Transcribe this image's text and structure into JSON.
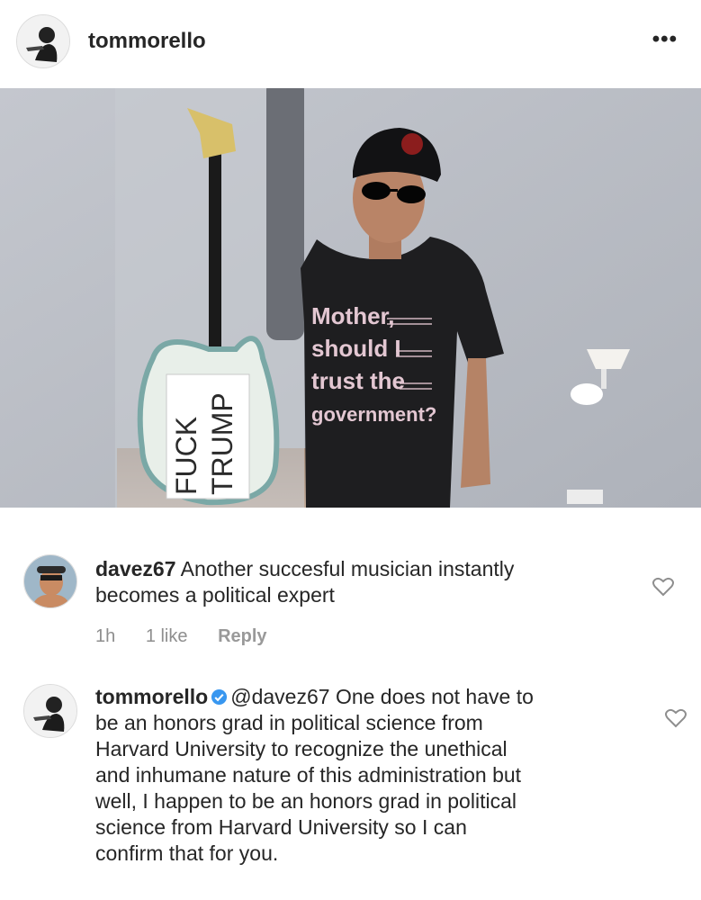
{
  "post": {
    "username": "tommorello",
    "avatar_icon": "guitarist-avatar",
    "more_icon": "more-options-icon",
    "photo": {
      "guitar_sticker_line1": "FUCK",
      "guitar_sticker_line2": "TRUMP",
      "shirt_text": [
        "Mother,",
        "should I",
        "trust the",
        "government?"
      ]
    }
  },
  "comments": [
    {
      "username": "davez67",
      "text_line1": "Another succesful musician instantly",
      "text_line2": "becomes a political expert",
      "time": "1h",
      "likes": "1 like",
      "reply_label": "Reply"
    },
    {
      "username": "tommorello",
      "verified": true,
      "mention": "@davez67",
      "lines": [
        "One does not have to",
        "be an honors grad in political science from",
        "Harvard University to recognize the unethical",
        "and inhumane nature of this administration but",
        "well, I happen to be an honors grad in political",
        "science from Harvard University so I can",
        "confirm that for you."
      ]
    }
  ],
  "colors": {
    "text": "#262626",
    "meta": "#8e8e8e",
    "verified": "#3897f0",
    "wall": "#b9bcc3"
  }
}
